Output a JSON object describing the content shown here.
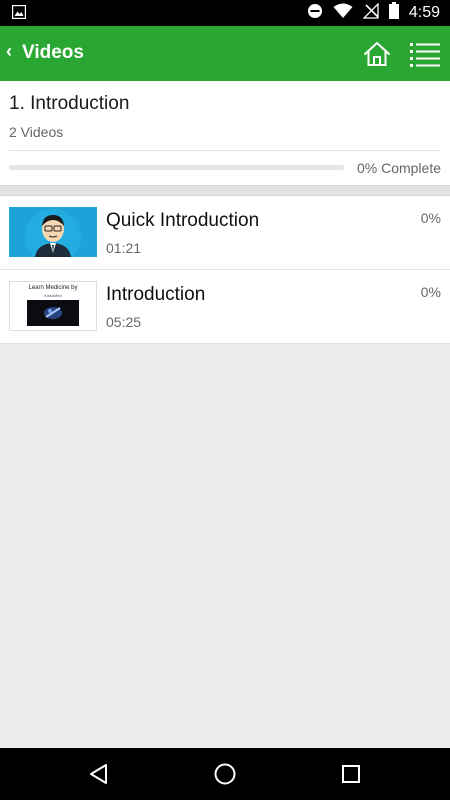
{
  "status_bar": {
    "time": "4:59",
    "icons": [
      "image-notification-icon",
      "do-not-disturb-icon",
      "wifi-icon",
      "no-signal-icon",
      "battery-icon"
    ]
  },
  "app_bar": {
    "back_glyph": "‹",
    "title": "Videos",
    "color": "#2aa632"
  },
  "section": {
    "title": "1. Introduction",
    "count": "2 Videos",
    "progress_fraction": 0,
    "progress_text": "0% Complete"
  },
  "videos": [
    {
      "title": "Quick Introduction",
      "duration": "01:21",
      "percent": "0%",
      "thumbnail": "cartoon-presenter"
    },
    {
      "title": "Introduction",
      "duration": "05:25",
      "percent": "0%",
      "thumbnail": "learn-medicine-slide",
      "thumb_caption": "Learn Medicine by",
      "thumb_subcaption": "KissoMed"
    }
  ],
  "nav_bar": {
    "icons": [
      "back-icon",
      "home-circle-icon",
      "recents-icon"
    ]
  }
}
